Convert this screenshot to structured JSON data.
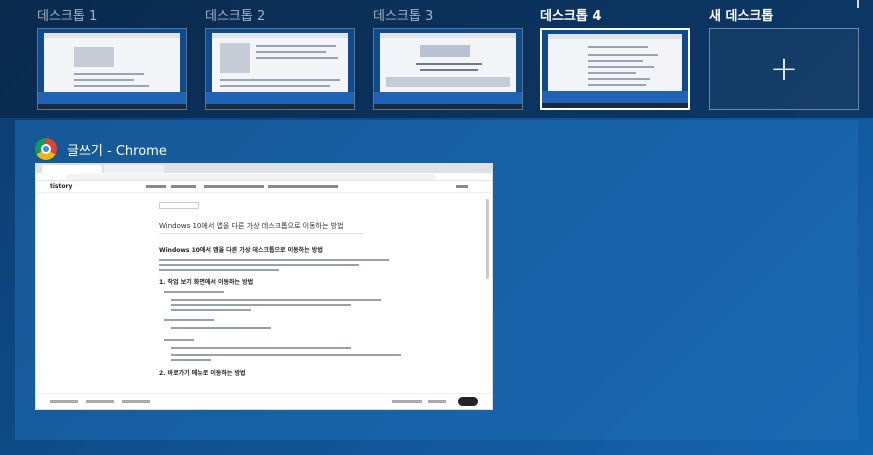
{
  "desktops": [
    {
      "label": "데스크톱 1",
      "active": false
    },
    {
      "label": "데스크톱 2",
      "active": false
    },
    {
      "label": "데스크톱 3",
      "active": false
    },
    {
      "label": "데스크톱 4",
      "active": true
    }
  ],
  "new_desktop": {
    "label": "새 데스크톱",
    "icon": "plus-icon"
  },
  "window": {
    "title": "글쓰기 - Chrome",
    "icon": "chrome-icon",
    "preview": {
      "blog_logo": "tistory",
      "post_title": "Windows 10에서 앱을 다른 가상 데스크톱으로 이동하는 방법",
      "heading_main": "Windows 10에서 앱을 다른 가상 데스크톱으로 이동하는 방법",
      "section_1": "1. 작업 보기 화면에서 이동하는 방법",
      "section_2": "2. 바로가기 메뉴로 이동하는 방법"
    }
  },
  "colors": {
    "background": "#0f4f8f",
    "active_border": "#ffffff",
    "label_inactive": "#9fb3c8"
  }
}
